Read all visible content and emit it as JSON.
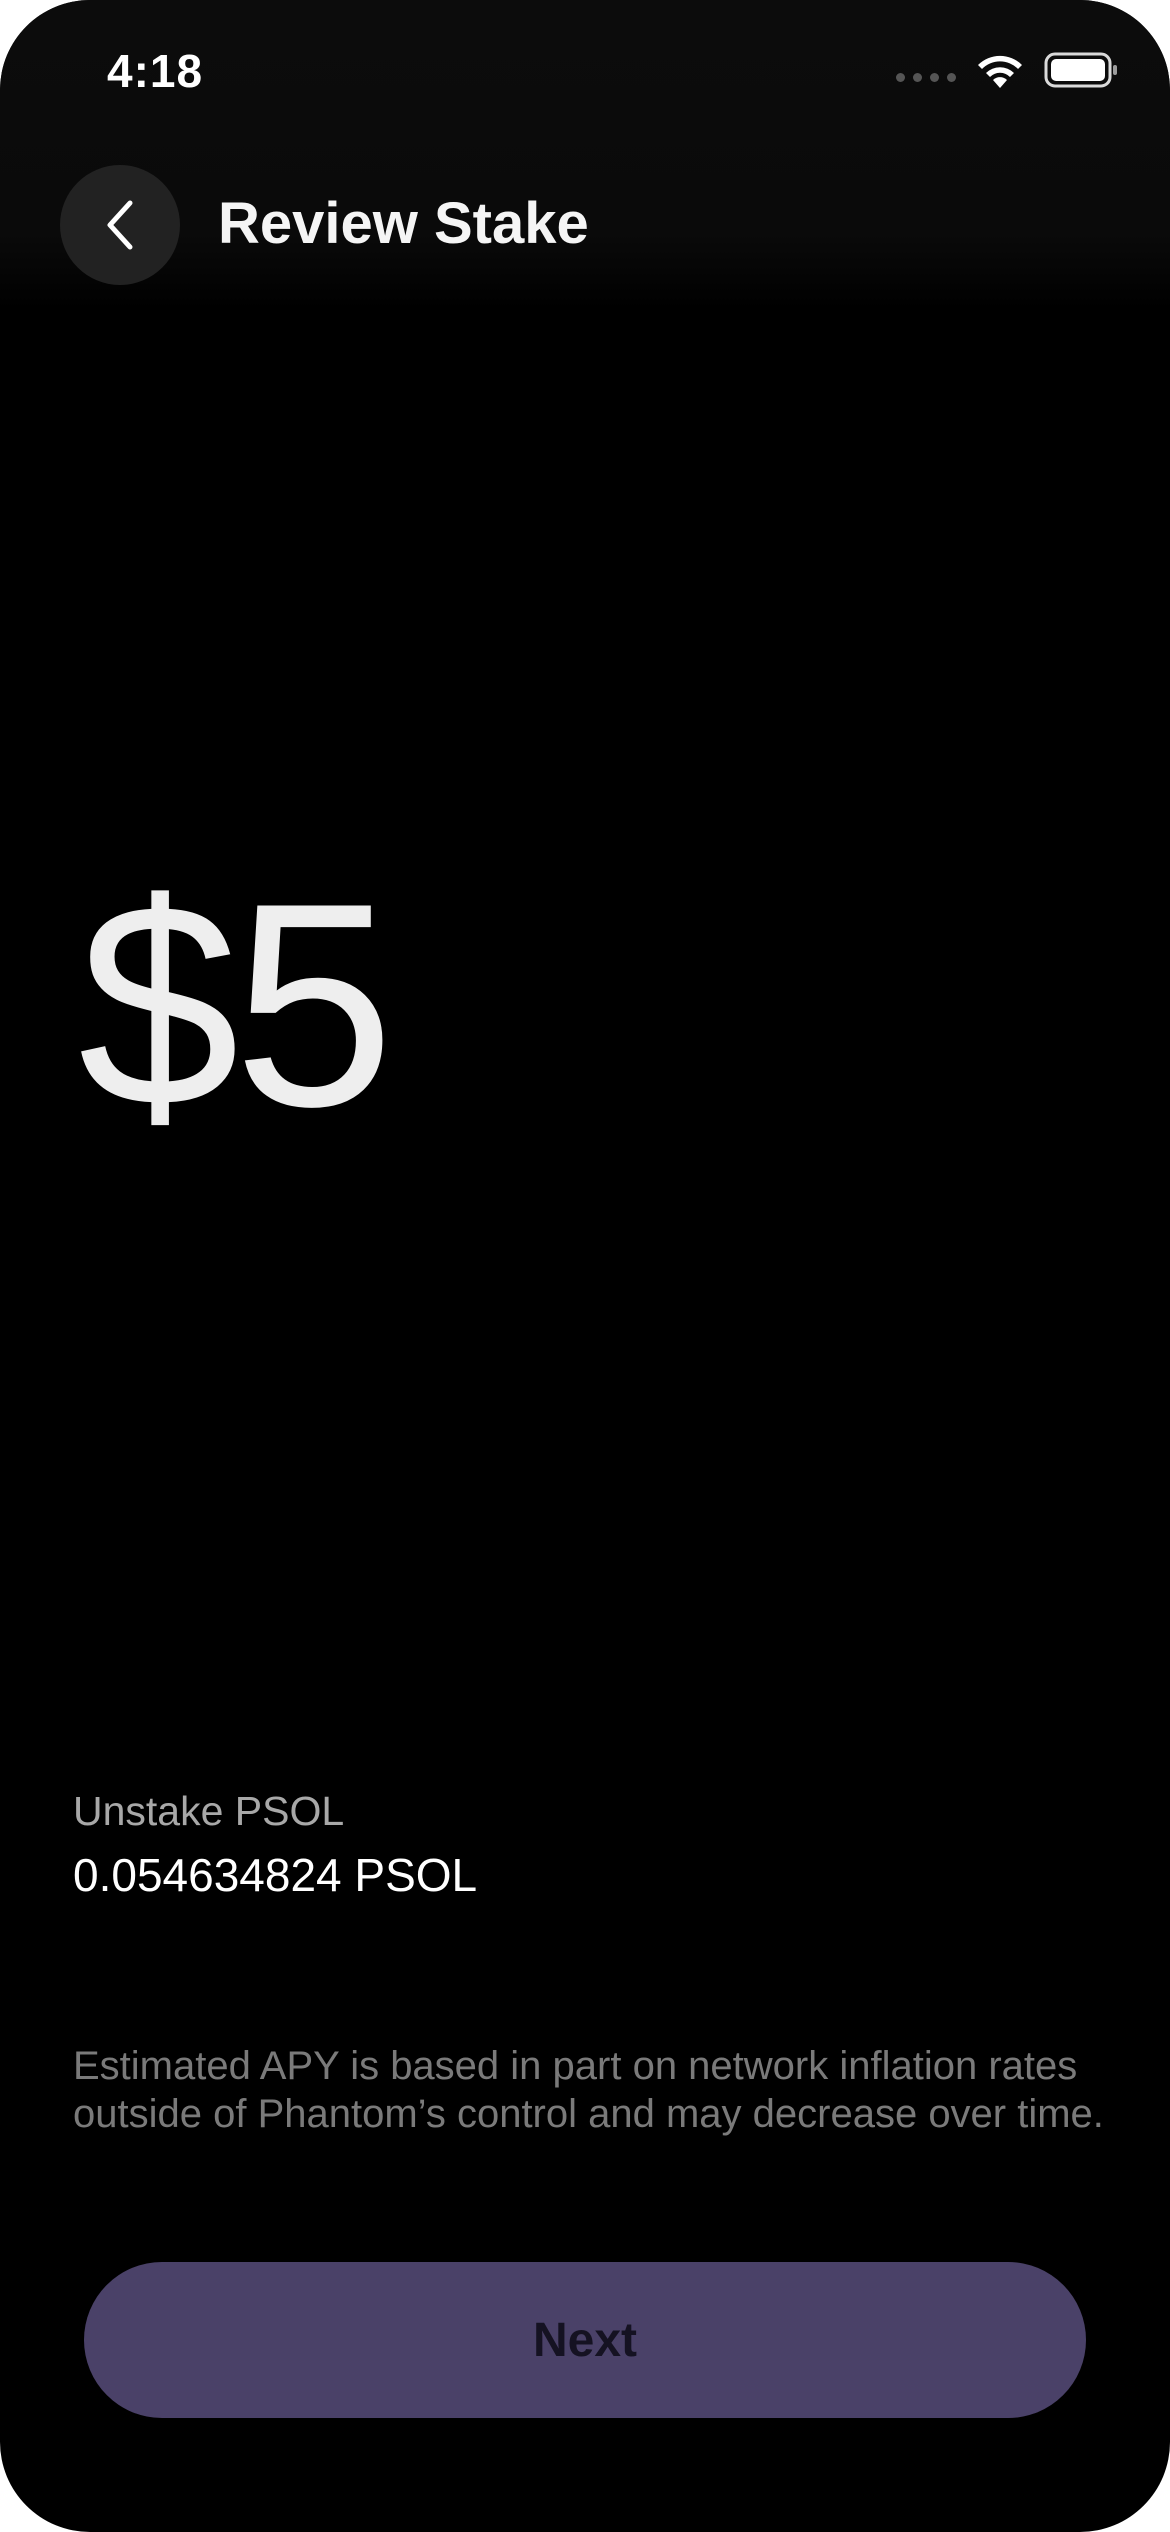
{
  "status_bar": {
    "time": "4:18",
    "icons": [
      "signal-icon",
      "wifi-icon",
      "battery-icon"
    ]
  },
  "header": {
    "back_icon": "chevron-left-icon",
    "title": "Review Stake"
  },
  "amount": {
    "display": "$5"
  },
  "unstake": {
    "label": "Unstake PSOL",
    "value": "0.054634824 PSOL"
  },
  "disclaimer": "Estimated APY is based in part on network inflation rates outside of Phantom’s control and may decrease over time.",
  "actions": {
    "next_label": "Next"
  },
  "colors": {
    "background": "#000000",
    "button_accent": "#4a4168",
    "button_text": "#151222",
    "secondary_text": "#a8a8a8",
    "muted_text": "#7a7a7a"
  }
}
